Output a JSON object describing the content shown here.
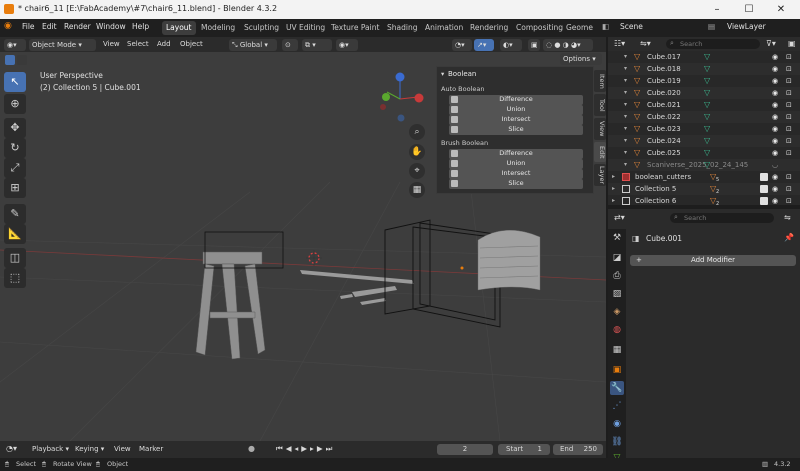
{
  "window": {
    "title": "* chair6_11 [E:\\FabAcademy\\#7\\chair6_11.blend] - Blender 4.3.2"
  },
  "menubar": {
    "menus": [
      "File",
      "Edit",
      "Render",
      "Window",
      "Help"
    ],
    "workspaces": [
      "Layout",
      "Modeling",
      "Sculpting",
      "UV Editing",
      "Texture Paint",
      "Shading",
      "Animation",
      "Rendering",
      "Compositing",
      "Geome"
    ],
    "scene": "Scene",
    "view_layer": "ViewLayer"
  },
  "viewport_header": {
    "mode": "Object Mode",
    "menus": [
      "View",
      "Select",
      "Add",
      "Object"
    ],
    "orientation": "Global",
    "options": "Options"
  },
  "viewport": {
    "perspective": "User Perspective",
    "info": "(2) Collection 5 | Cube.001"
  },
  "boolean_panel": {
    "title": "Boolean",
    "auto_label": "Auto Boolean",
    "auto_buttons": [
      "Difference",
      "Union",
      "Intersect",
      "Slice"
    ],
    "brush_label": "Brush Boolean",
    "brush_buttons": [
      "Difference",
      "Union",
      "Intersect",
      "Slice"
    ]
  },
  "side_tabs": [
    "Item",
    "Tool",
    "View",
    "Edit",
    "Layer"
  ],
  "outliner": {
    "search_placeholder": "Search",
    "rows": [
      {
        "name": "Cube.017",
        "type": "mesh"
      },
      {
        "name": "Cube.018",
        "type": "mesh"
      },
      {
        "name": "Cube.019",
        "type": "mesh"
      },
      {
        "name": "Cube.020",
        "type": "mesh"
      },
      {
        "name": "Cube.021",
        "type": "mesh"
      },
      {
        "name": "Cube.022",
        "type": "mesh"
      },
      {
        "name": "Cube.023",
        "type": "mesh"
      },
      {
        "name": "Cube.024",
        "type": "mesh"
      },
      {
        "name": "Cube.025",
        "type": "mesh"
      },
      {
        "name": "Scaniverse_2025_02_24_145",
        "type": "mesh-dim"
      },
      {
        "name": "boolean_cutters",
        "type": "collection-red",
        "badge": "5"
      },
      {
        "name": "Collection 5",
        "type": "collection",
        "badge": "2"
      },
      {
        "name": "Collection 6",
        "type": "collection",
        "badge": "2"
      }
    ]
  },
  "properties": {
    "search_placeholder": "Search",
    "object_name": "Cube.001",
    "add_modifier": "Add Modifier"
  },
  "timeline": {
    "menus": [
      "Playback",
      "Keying",
      "View",
      "Marker"
    ],
    "current_frame": "2",
    "start_label": "Start",
    "start": "1",
    "end_label": "End",
    "end": "250"
  },
  "statusbar": {
    "items": [
      "Select",
      "Rotate View",
      "Object"
    ],
    "version": "4.3.2"
  },
  "colors": {
    "accent": "#4772b3",
    "orange": "#e87d0d",
    "mesh_icon": "#e0853a"
  }
}
